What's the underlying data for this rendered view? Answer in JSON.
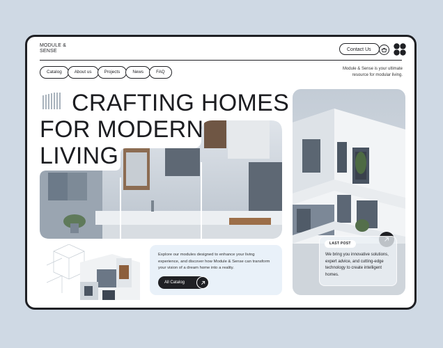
{
  "brand": {
    "line1": "MODULE &",
    "line2": "SENSE"
  },
  "header": {
    "contact_label": "Contact Us"
  },
  "nav": {
    "items": [
      {
        "label": "Catalog"
      },
      {
        "label": "About us"
      },
      {
        "label": "Projects"
      },
      {
        "label": "News"
      },
      {
        "label": "FAQ"
      }
    ]
  },
  "tagline": {
    "line1": "Module & Sense is your ultimate",
    "line2": "resource for modular living."
  },
  "hero": {
    "line1": "CRAFTING HOMES",
    "line2": "FOR MODERN",
    "line3": "LIVING"
  },
  "info": {
    "text": "Explore our modules designed to enhance your living experience, and discover how Module & Sense can transform your vision of a dream home into a reality.",
    "button_label": "All Catalog"
  },
  "last_post": {
    "badge": "LAST POST",
    "text": "We bring you innovative solutions, expert advice, and cutting-edge technology to create intelligent homes."
  },
  "icons": {
    "basket": "basket-icon",
    "menu": "menu-icon",
    "arrow": "arrow-up-right-icon"
  },
  "colors": {
    "page_bg": "#cfd9e4",
    "frame": "#1f2024",
    "card": "#e9f1f9",
    "accent_dark": "#1f2024"
  }
}
